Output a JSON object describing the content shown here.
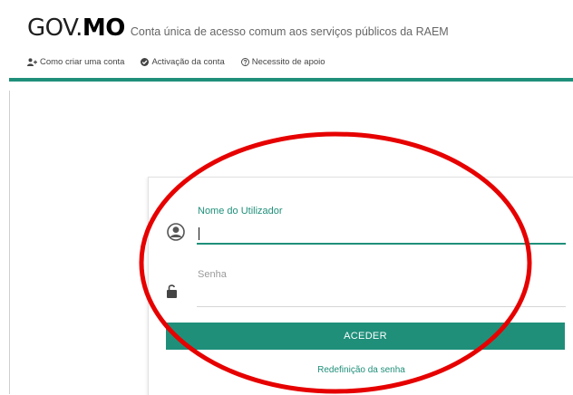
{
  "colors": {
    "accent": "#1f8f7a",
    "annotation": "#e60000"
  },
  "header": {
    "logo_prefix": "GOV.",
    "logo_suffix": "MO",
    "tagline": "Conta única de acesso comum aos serviços públicos da RAEM"
  },
  "nav": {
    "items": [
      {
        "label": "Como criar uma conta",
        "icon": "add-user-icon"
      },
      {
        "label": "Activação da conta",
        "icon": "check-circle-icon"
      },
      {
        "label": "Necessito de apoio",
        "icon": "help-icon"
      }
    ]
  },
  "login": {
    "username_label": "Nome do Utilizador",
    "username_value": "",
    "password_label": "Senha",
    "password_value": "",
    "submit_label": "ACEDER",
    "reset_link": "Redefinição da senha"
  },
  "annotation": {
    "shape": "ellipse",
    "color": "#e60000"
  }
}
